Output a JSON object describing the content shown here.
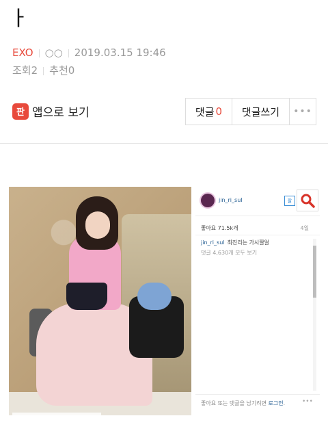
{
  "post": {
    "title": "ㅏ",
    "category": "EXO",
    "author": "○○",
    "datetime": "2019.03.15 19:46",
    "views_label": "조회",
    "views": "2",
    "recommend_label": "추천",
    "recommend": "0"
  },
  "actions": {
    "app_icon_text": "판",
    "app_view": "앱으로 보기",
    "comments_label": "댓글",
    "comments_count": "0",
    "write_comment": "댓글쓰기",
    "more": "•••"
  },
  "instagram": {
    "username": "jin_ri_sul",
    "follow": "팔",
    "likes": "좋아요 71.5k개",
    "age": "4일",
    "caption_user": "jin_ri_sul",
    "caption_text": "최진리는 가시짤얼",
    "all_comments": "댓글 4,630개 모두 보기",
    "footer_text": "좋아요 또는 댓글을 남기려면",
    "footer_login": "로그인",
    "footer_dots": "•••"
  },
  "colors": {
    "accent": "#e84a3c",
    "link": "#1f5a8f"
  },
  "icons": [
    "search-icon",
    "more-icon",
    "app-icon"
  ]
}
